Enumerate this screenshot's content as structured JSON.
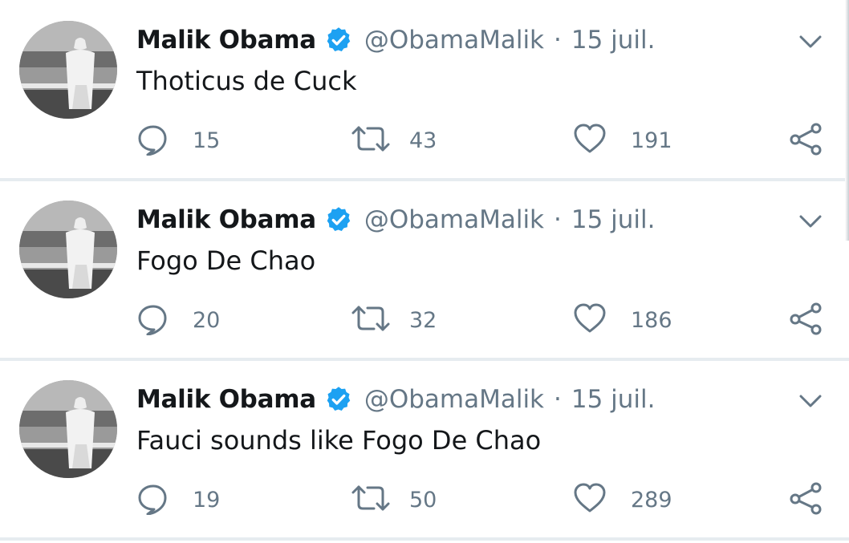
{
  "tweets": [
    {
      "author_name": "Malik Obama",
      "handle": "@ObamaMalik",
      "separator": "·",
      "date": "15 juil.",
      "text": "Thoticus de Cuck",
      "replies": "15",
      "retweets": "43",
      "likes": "191"
    },
    {
      "author_name": "Malik Obama",
      "handle": "@ObamaMalik",
      "separator": "·",
      "date": "15 juil.",
      "text": "Fogo De Chao",
      "replies": "20",
      "retweets": "32",
      "likes": "186"
    },
    {
      "author_name": "Malik Obama",
      "handle": "@ObamaMalik",
      "separator": "·",
      "date": "15 juil.",
      "text": "Fauci sounds like Fogo De Chao",
      "replies": "19",
      "retweets": "50",
      "likes": "289"
    }
  ],
  "icons": {
    "verified": "verified-badge-icon",
    "menu": "chevron-down-icon",
    "reply": "reply-icon",
    "retweet": "retweet-icon",
    "like": "heart-icon",
    "share": "share-icon"
  },
  "colors": {
    "verified": "#1da1f2",
    "icon_gray": "#657786",
    "text": "#14171a",
    "divider": "#e6ecf0"
  }
}
